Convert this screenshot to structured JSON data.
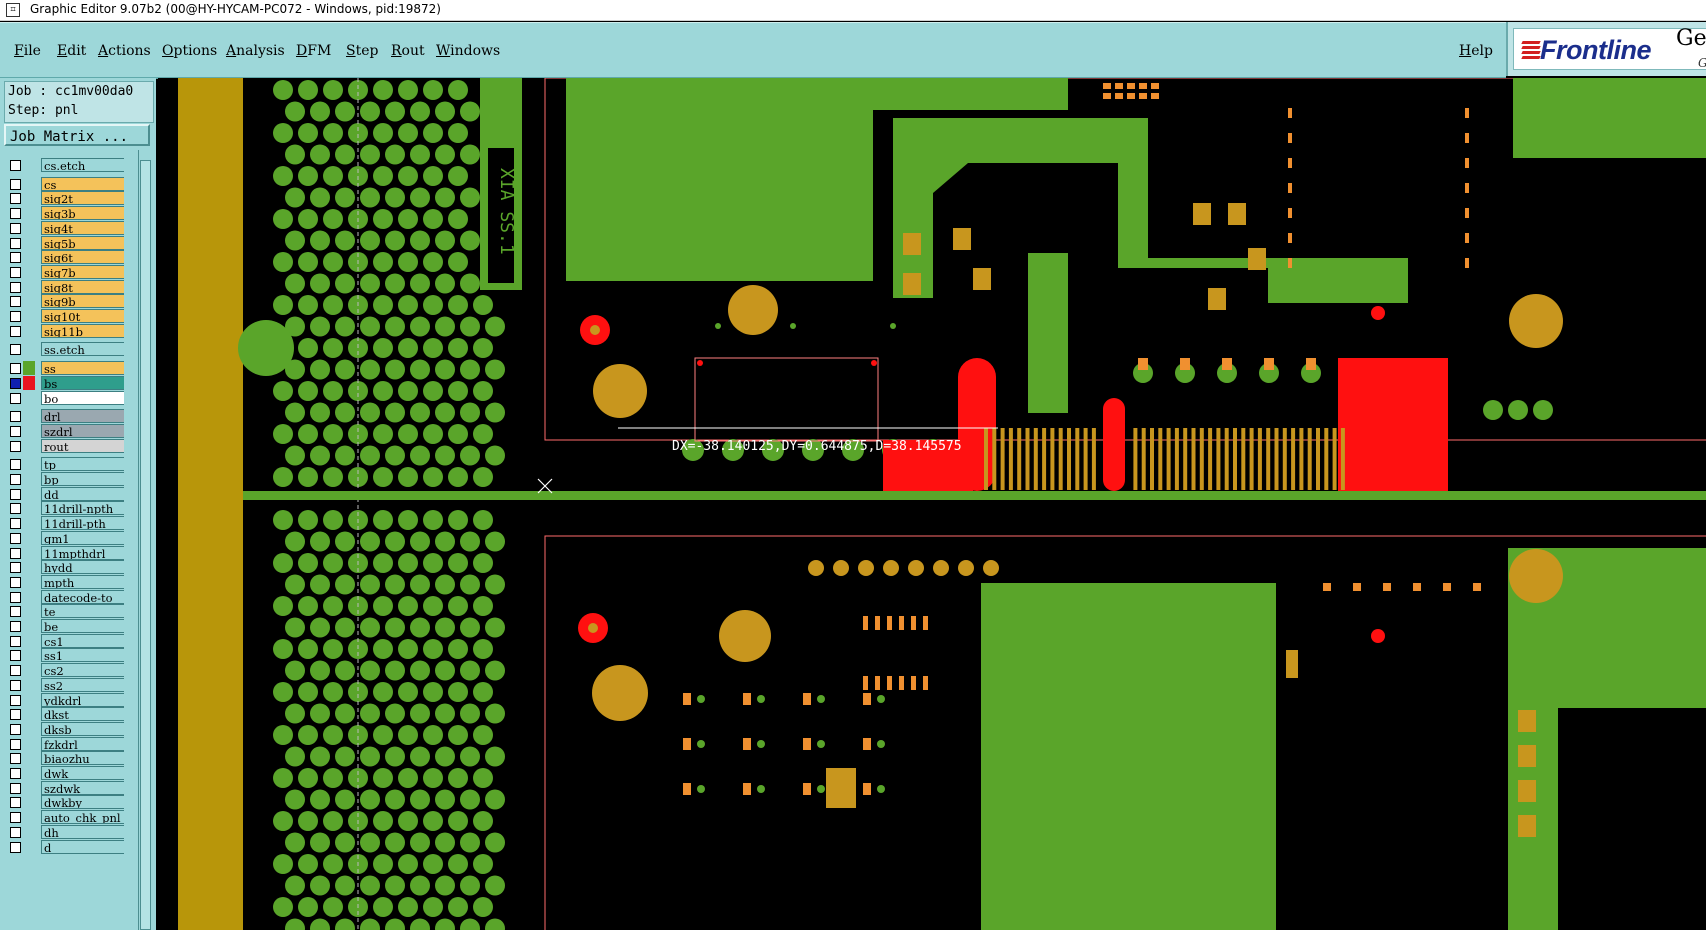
{
  "window": {
    "title": "Graphic Editor 9.07b2 (00@HY-HYCAM-PC072 - Windows, pid:19872)"
  },
  "menu": {
    "items": [
      "File",
      "Edit",
      "Actions",
      "Options",
      "Analysis",
      "DFM",
      "Step",
      "Rout",
      "Windows"
    ],
    "help": "Help"
  },
  "brand": {
    "logo_text": "Frontline",
    "ge_text": "Ge",
    "g_text": "G"
  },
  "job": {
    "job_line": "Job : cc1mv00da0",
    "step_line": "Step: pnl",
    "matrix_button": "Job Matrix ..."
  },
  "layers": [
    {
      "name": "cs.etch",
      "color": "#9dd7d9",
      "swatch": "#9dd7d9"
    },
    {
      "name": "cs",
      "color": "#f4c25a",
      "swatch": "#9dd7d9"
    },
    {
      "name": "sig2t",
      "color": "#f4c25a",
      "swatch": "#9dd7d9"
    },
    {
      "name": "sig3b",
      "color": "#f4c25a",
      "swatch": "#9dd7d9"
    },
    {
      "name": "sig4t",
      "color": "#f4c25a",
      "swatch": "#9dd7d9"
    },
    {
      "name": "sig5b",
      "color": "#f4c25a",
      "swatch": "#9dd7d9"
    },
    {
      "name": "sig6t",
      "color": "#f4c25a",
      "swatch": "#9dd7d9"
    },
    {
      "name": "sig7b",
      "color": "#f4c25a",
      "swatch": "#9dd7d9"
    },
    {
      "name": "sig8t",
      "color": "#f4c25a",
      "swatch": "#9dd7d9"
    },
    {
      "name": "sig9b",
      "color": "#f4c25a",
      "swatch": "#9dd7d9"
    },
    {
      "name": "sig10t",
      "color": "#f4c25a",
      "swatch": "#9dd7d9"
    },
    {
      "name": "sig11b",
      "color": "#f4c25a",
      "swatch": "#9dd7d9"
    },
    {
      "name": "ss.etch",
      "color": "#9dd7d9",
      "swatch": "#9dd7d9"
    },
    {
      "name": "ss",
      "color": "#f4c25a",
      "swatch": "#5aa52a"
    },
    {
      "name": "bs",
      "color": "#2f9e8c",
      "swatch": "#e8141e",
      "checked": true
    },
    {
      "name": "bo",
      "color": "#ffffff",
      "swatch": "#9dd7d9"
    },
    {
      "name": "drl",
      "color": "#9aa8b0",
      "swatch": "#9dd7d9"
    },
    {
      "name": "szdrl",
      "color": "#9aa8b0",
      "swatch": "#9dd7d9"
    },
    {
      "name": "rout",
      "color": "#d4d4d4",
      "swatch": "#9dd7d9"
    },
    {
      "name": "tp",
      "color": "#9dd7d9",
      "swatch": "#9dd7d9"
    },
    {
      "name": "bp",
      "color": "#9dd7d9",
      "swatch": "#9dd7d9"
    },
    {
      "name": "dd",
      "color": "#9dd7d9",
      "swatch": "#9dd7d9"
    },
    {
      "name": "11drill-npth",
      "color": "#9dd7d9",
      "swatch": "#9dd7d9"
    },
    {
      "name": "11drill-pth",
      "color": "#9dd7d9",
      "swatch": "#9dd7d9"
    },
    {
      "name": "gm1",
      "color": "#9dd7d9",
      "swatch": "#9dd7d9"
    },
    {
      "name": "11mpthdrl",
      "color": "#9dd7d9",
      "swatch": "#9dd7d9"
    },
    {
      "name": "hydd",
      "color": "#9dd7d9",
      "swatch": "#9dd7d9"
    },
    {
      "name": "mpth",
      "color": "#9dd7d9",
      "swatch": "#9dd7d9"
    },
    {
      "name": "datecode-to",
      "color": "#9dd7d9",
      "swatch": "#9dd7d9"
    },
    {
      "name": "te",
      "color": "#9dd7d9",
      "swatch": "#9dd7d9"
    },
    {
      "name": "be",
      "color": "#9dd7d9",
      "swatch": "#9dd7d9"
    },
    {
      "name": "cs1",
      "color": "#9dd7d9",
      "swatch": "#9dd7d9"
    },
    {
      "name": "ss1",
      "color": "#9dd7d9",
      "swatch": "#9dd7d9"
    },
    {
      "name": "cs2",
      "color": "#9dd7d9",
      "swatch": "#9dd7d9"
    },
    {
      "name": "ss2",
      "color": "#9dd7d9",
      "swatch": "#9dd7d9"
    },
    {
      "name": "ydkdrl",
      "color": "#9dd7d9",
      "swatch": "#9dd7d9"
    },
    {
      "name": "dkst",
      "color": "#9dd7d9",
      "swatch": "#9dd7d9"
    },
    {
      "name": "dksb",
      "color": "#9dd7d9",
      "swatch": "#9dd7d9"
    },
    {
      "name": "fzkdrl",
      "color": "#9dd7d9",
      "swatch": "#9dd7d9"
    },
    {
      "name": "biaozhu",
      "color": "#9dd7d9",
      "swatch": "#9dd7d9"
    },
    {
      "name": "dwk",
      "color": "#9dd7d9",
      "swatch": "#9dd7d9"
    },
    {
      "name": "szdwk",
      "color": "#9dd7d9",
      "swatch": "#9dd7d9"
    },
    {
      "name": "dwkby",
      "color": "#9dd7d9",
      "swatch": "#9dd7d9"
    },
    {
      "name": "auto_chk_pnl",
      "color": "#9dd7d9",
      "swatch": "#9dd7d9"
    },
    {
      "name": "dh",
      "color": "#9dd7d9",
      "swatch": "#9dd7d9"
    },
    {
      "name": "d",
      "color": "#9dd7d9",
      "swatch": "#9dd7d9"
    }
  ],
  "canvas": {
    "measure_text": "DX=-38.140125,DY=0.644875,D=38.145575",
    "board_marking": "XIA SS.1",
    "colors": {
      "green": "#5aa52a",
      "gold": "#c8961e",
      "red": "#ff1010",
      "orange": "#f09030",
      "tan": "#b8960a"
    }
  }
}
